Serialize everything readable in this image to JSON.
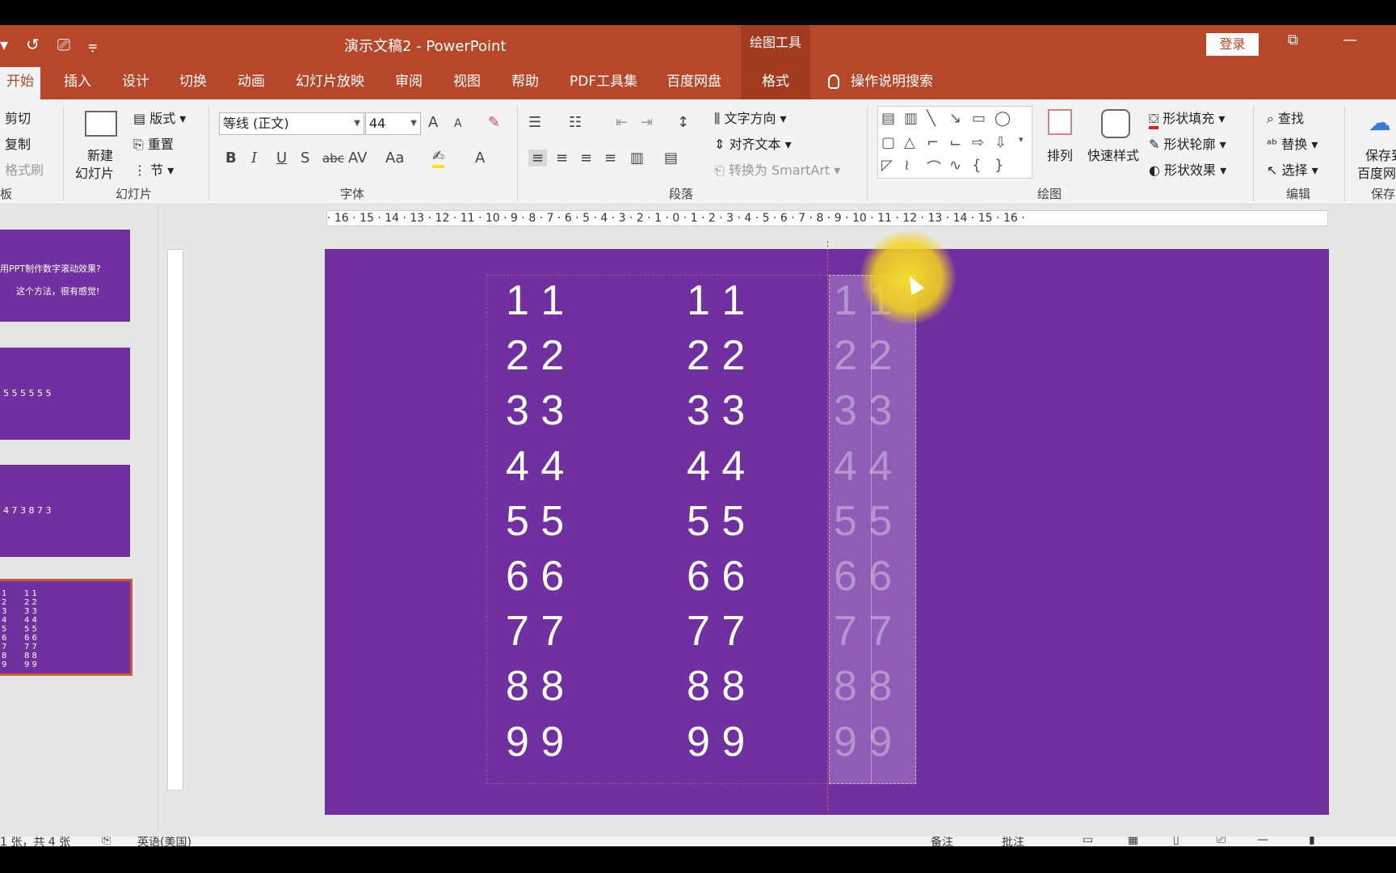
{
  "title_bar": {
    "qat_items": [
      "▾",
      "↺",
      "⎚",
      "⩦"
    ],
    "doc_title": "演示文稿2  -  PowerPoint",
    "context_tool": "绘图工具",
    "login": "登录",
    "restore_icon": "⧉",
    "minimize_icon": "—"
  },
  "tabs": [
    {
      "label": "开始",
      "active": true
    },
    {
      "label": "插入"
    },
    {
      "label": "设计"
    },
    {
      "label": "切换"
    },
    {
      "label": "动画"
    },
    {
      "label": "幻灯片放映"
    },
    {
      "label": "审阅"
    },
    {
      "label": "视图"
    },
    {
      "label": "帮助"
    },
    {
      "label": "PDF工具集"
    },
    {
      "label": "百度网盘"
    },
    {
      "label": "格式"
    }
  ],
  "tell_me": "操作说明搜索",
  "ribbon": {
    "clipboard": {
      "cut": "剪切",
      "copy": "复制",
      "format_painter": "格式刷",
      "label": "板"
    },
    "slides": {
      "new_slide_1": "新建",
      "new_slide_2": "幻灯片",
      "layout": "版式",
      "reset": "重置",
      "section": "节",
      "label": "幻灯片"
    },
    "font": {
      "name": "等线 (正文)",
      "size": "44",
      "label": "字体",
      "bold": "B",
      "italic": "I",
      "underline": "U",
      "shadow": "S",
      "strike": "abc",
      "spacing": "AV",
      "case": "Aa",
      "grow": "A",
      "shrink": "A",
      "color": "A"
    },
    "paragraph": {
      "text_direction": "文字方向",
      "align_text": "对齐文本",
      "smartart": "转换为 SmartArt",
      "label": "段落"
    },
    "drawing": {
      "arrange": "排列",
      "quick_styles": "快速样式",
      "fill": "形状填充",
      "outline": "形状轮廓",
      "effects": "形状效果",
      "label": "绘图"
    },
    "editing": {
      "find": "查找",
      "replace": "替换",
      "select": "选择",
      "label": "编辑"
    },
    "save": {
      "line1": "保存到",
      "line2": "百度网",
      "label": "保存"
    }
  },
  "thumbnails": [
    {
      "line1": "用PPT制作数字滚动效果?",
      "line2": "这个方法，很有感觉!"
    },
    {
      "line1": "5 5     5 5     5 5"
    },
    {
      "line1": "4 7     3 8     7 3"
    },
    {
      "grid_left": [
        "1",
        "2",
        "3",
        "4",
        "5",
        "6",
        "7",
        "8",
        "9"
      ],
      "grid_right": [
        "1 1",
        "2 2",
        "3 3",
        "4 4",
        "5 5",
        "6 6",
        "7 7",
        "8 8",
        "9 9"
      ]
    }
  ],
  "ruler_text": "· 16 · 15 · 14 · 13 · 12 · 11 · 10 · 9 · 8 · 7 · 6 · 5 · 4 · 3 · 2 · 1 · 0 · 1 · 2 · 3 · 4 · 5 · 6 · 7 · 8 · 9 · 10 · 11 · 12 · 13 · 14 · 15 · 16 ·",
  "slide": {
    "column_a": [
      "1 1",
      "2 2",
      "3 3",
      "4 4",
      "5 5",
      "6 6",
      "7 7",
      "8 8",
      "9 9"
    ],
    "column_b": [
      "1 1",
      "2 2",
      "3 3",
      "4 4",
      "5 5",
      "6 6",
      "7 7",
      "8 8",
      "9 9"
    ],
    "column_c": [
      "1 1",
      "2 2",
      "3 3",
      "4 4",
      "5 5",
      "6 6",
      "7 7",
      "8 8",
      "9 9"
    ],
    "background_color": "#7030a0"
  },
  "status": {
    "slide_info": "1 张，共 4 张",
    "language": "英语(美国)",
    "notes": "备注",
    "comments": "批注"
  },
  "colors": {
    "accent": "#b7472a",
    "slide_bg": "#7030a0"
  }
}
